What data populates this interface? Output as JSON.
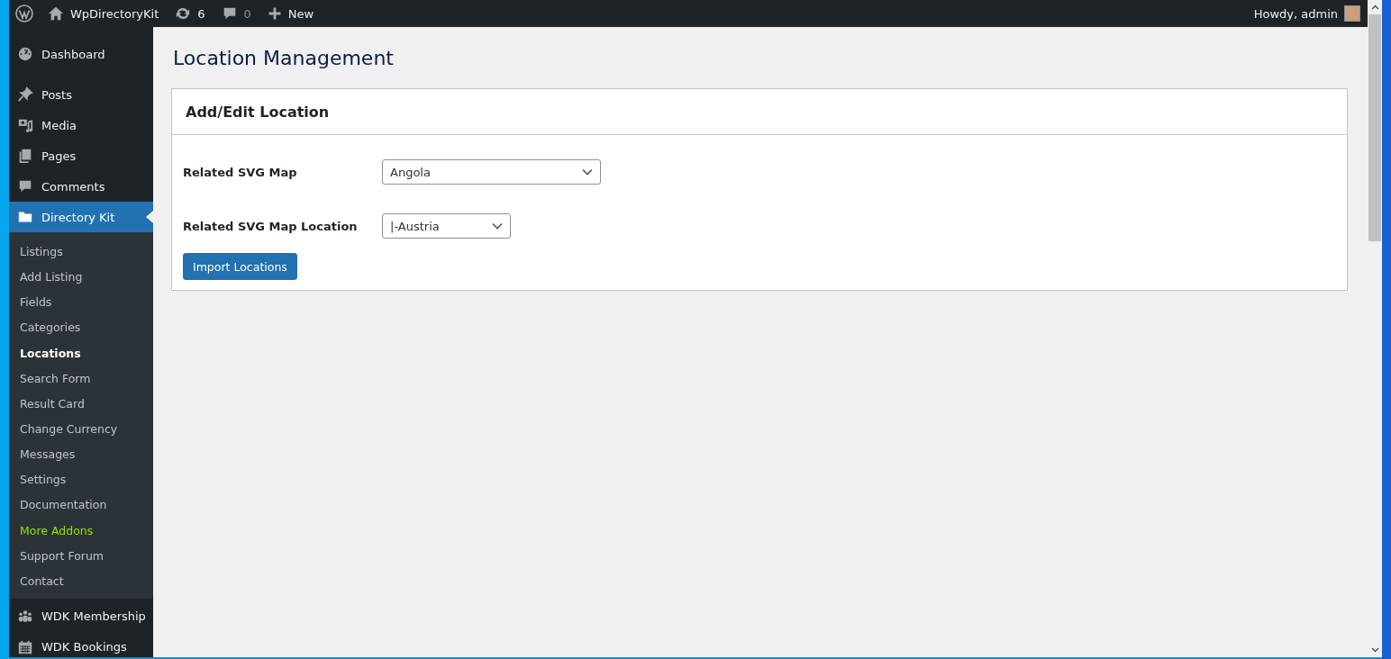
{
  "admin_bar": {
    "site_name": "WpDirectoryKit",
    "updates_count": "6",
    "comments_count": "0",
    "new_label": "New",
    "greeting": "Howdy, admin"
  },
  "sidebar": {
    "items": [
      {
        "label": "Dashboard",
        "selected": false
      },
      {
        "label": "Posts",
        "selected": false
      },
      {
        "label": "Media",
        "selected": false
      },
      {
        "label": "Pages",
        "selected": false
      },
      {
        "label": "Comments",
        "selected": false
      },
      {
        "label": "Directory Kit",
        "selected": true,
        "children": [
          {
            "label": "Listings",
            "selected": false,
            "color": "#c3c4c7"
          },
          {
            "label": "Add Listing",
            "selected": false,
            "color": "#c3c4c7"
          },
          {
            "label": "Fields",
            "selected": false,
            "color": "#c3c4c7"
          },
          {
            "label": "Categories",
            "selected": false,
            "color": "#c3c4c7"
          },
          {
            "label": "Locations",
            "selected": true,
            "color": "#ffffff"
          },
          {
            "label": "Search Form",
            "selected": false,
            "color": "#c3c4c7"
          },
          {
            "label": "Result Card",
            "selected": false,
            "color": "#c3c4c7"
          },
          {
            "label": "Change Currency",
            "selected": false,
            "color": "#c3c4c7"
          },
          {
            "label": "Messages",
            "selected": false,
            "color": "#c3c4c7"
          },
          {
            "label": "Settings",
            "selected": false,
            "color": "#c3c4c7"
          },
          {
            "label": "Documentation",
            "selected": false,
            "color": "#c3c4c7"
          },
          {
            "label": "More Addons",
            "selected": false,
            "color": "#93e003"
          },
          {
            "label": "Support Forum",
            "selected": false,
            "color": "#c3c4c7"
          },
          {
            "label": "Contact",
            "selected": false,
            "color": "#c3c4c7"
          }
        ]
      },
      {
        "label": "WDK Membership",
        "selected": false
      },
      {
        "label": "WDK Bookings",
        "selected": false
      }
    ]
  },
  "page": {
    "title": "Location Management",
    "panel_title": "Add/Edit Location",
    "fields": [
      {
        "kind": "select",
        "label": "Related SVG Map",
        "value": "Angola"
      },
      {
        "kind": "select",
        "label": "Related SVG Map Location",
        "value": "|-Austria"
      }
    ],
    "button": "Import Locations"
  }
}
